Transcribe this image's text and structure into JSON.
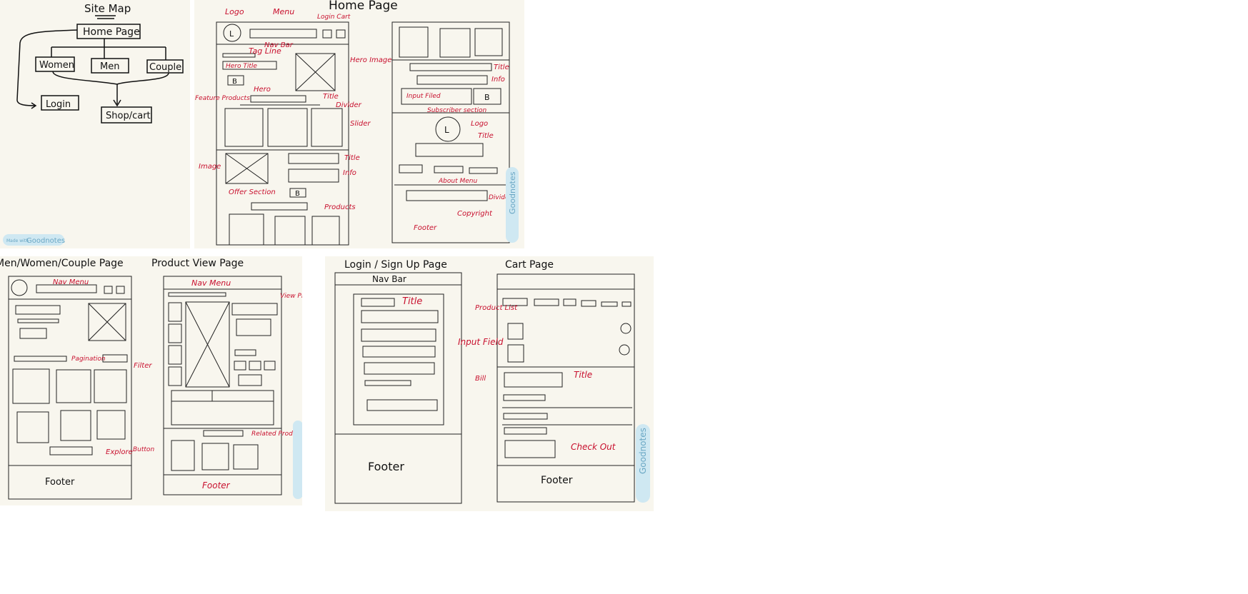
{
  "colors": {
    "paper": "#f8f6ee",
    "ink": "#111111",
    "annotation": "#c8102e",
    "badge": "#cfe8f2"
  },
  "badge": {
    "prefix": "Made with",
    "brand": "Goodnotes"
  },
  "sitemap": {
    "title": "Site Map",
    "nodes": {
      "home": "Home Page",
      "women": "Women",
      "men": "Men",
      "couple": "Couple",
      "login": "Login",
      "shop_cart": "Shop/cart"
    }
  },
  "home": {
    "title": "Home Page",
    "logo_glyph": "L",
    "button_glyph": "B",
    "labels": {
      "logo": "Logo",
      "menu": "Menu",
      "login_cart": "Login Cart",
      "nav_bar": "Nav Bar",
      "tag_line": "Tag Line",
      "hero_title": "Hero Title",
      "hero_image": "Hero Image",
      "hero": "Hero",
      "title": "Title",
      "divider": "Divider",
      "featured_products": "Feature Products",
      "slider": "Slider",
      "image": "Image",
      "info": "Info",
      "offer_section": "Offer Section",
      "products": "Products",
      "input_filed": "Input Filed",
      "subscriber_section": "Subscriber section",
      "logo2": "Logo",
      "about_menu": "About Menu",
      "copyright": "Copyright",
      "footer": "Footer"
    }
  },
  "category": {
    "title": "Men/Women/Couple Page",
    "labels": {
      "nav_menu": "Nav Menu",
      "pagination": "Pagination",
      "filter": "Filter",
      "explore": "Explore",
      "button": "Button",
      "footer": "Footer"
    }
  },
  "product": {
    "title": "Product View Page",
    "labels": {
      "nav_menu": "Nav Menu",
      "view_product_section": "View Product Section",
      "related_product_slider": "Related Product Slider",
      "footer": "Footer"
    }
  },
  "login": {
    "title": "Login / Sign Up Page",
    "labels": {
      "nav_bar": "Nav Bar",
      "title": "Title",
      "input_field": "Input Field",
      "footer": "Footer"
    }
  },
  "cart": {
    "title": "Cart Page",
    "labels": {
      "product_list": "Product List",
      "bill": "Bill",
      "title": "Title",
      "check_out": "Check Out",
      "footer": "Footer"
    }
  }
}
